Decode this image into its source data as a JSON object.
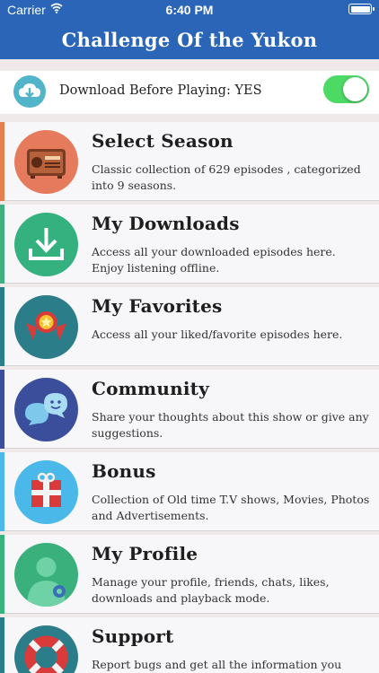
{
  "status_bar": {
    "carrier": "Carrier",
    "time": "6:40 PM"
  },
  "header": {
    "title": "Challenge Of the Yukon"
  },
  "download_bar": {
    "label": "Download Before Playing: YES",
    "toggle_on": true
  },
  "menu": [
    {
      "title": "Select Season",
      "description": "Classic collection of 629 episodes , categorized into 9 seasons.",
      "accent": "#e67e4f",
      "icon": "radio-icon",
      "icon_bg": "#e57a5c"
    },
    {
      "title": "My Downloads",
      "description": "Access all your downloaded episodes here. Enjoy listening offline.",
      "accent": "#3fb27f",
      "icon": "download-icon",
      "icon_bg": "#35b07f"
    },
    {
      "title": "My Favorites",
      "description": "Access all your liked/favorite episodes here.",
      "accent": "#2c7d8a",
      "icon": "medal-icon",
      "icon_bg": "#2c7d8a"
    },
    {
      "title": "Community",
      "description": "Share your thoughts about this show or give any suggestions.",
      "accent": "#3a4e9c",
      "icon": "chat-icon",
      "icon_bg": "#3a4e9c"
    },
    {
      "title": "Bonus",
      "description": "Collection of Old time T.V shows, Movies, Photos and Advertisements.",
      "accent": "#4ab8e8",
      "icon": "gift-icon",
      "icon_bg": "#4ab8e8"
    },
    {
      "title": "My Profile",
      "description": "Manage your profile, friends, chats, likes, downloads and playback mode.",
      "accent": "#39b27c",
      "icon": "profile-icon",
      "icon_bg": "#3ab17c"
    },
    {
      "title": "Support",
      "description": "Report bugs and get all the information you need to",
      "accent": "#2c7d8a",
      "icon": "lifebuoy-icon",
      "icon_bg": "#2c7d8a"
    }
  ]
}
